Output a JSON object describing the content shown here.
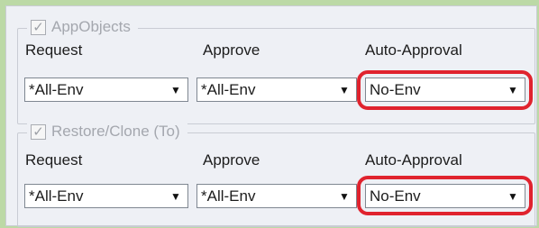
{
  "sections": [
    {
      "title": "AppObjects",
      "checked": true,
      "columns": [
        {
          "label": "Request",
          "value": "*All-Env"
        },
        {
          "label": "Approve",
          "value": "*All-Env"
        },
        {
          "label": "Auto-Approval",
          "value": "No-Env"
        }
      ]
    },
    {
      "title": "Restore/Clone (To)",
      "checked": true,
      "columns": [
        {
          "label": "Request",
          "value": "*All-Env"
        },
        {
          "label": "Approve",
          "value": "*All-Env"
        },
        {
          "label": "Auto-Approval",
          "value": "No-Env"
        }
      ]
    }
  ],
  "icons": {
    "checkbox_glyph": "✓",
    "dropdown_glyph": "▼"
  },
  "colors": {
    "highlight": "#e0232e",
    "background": "#bcd9a6"
  }
}
